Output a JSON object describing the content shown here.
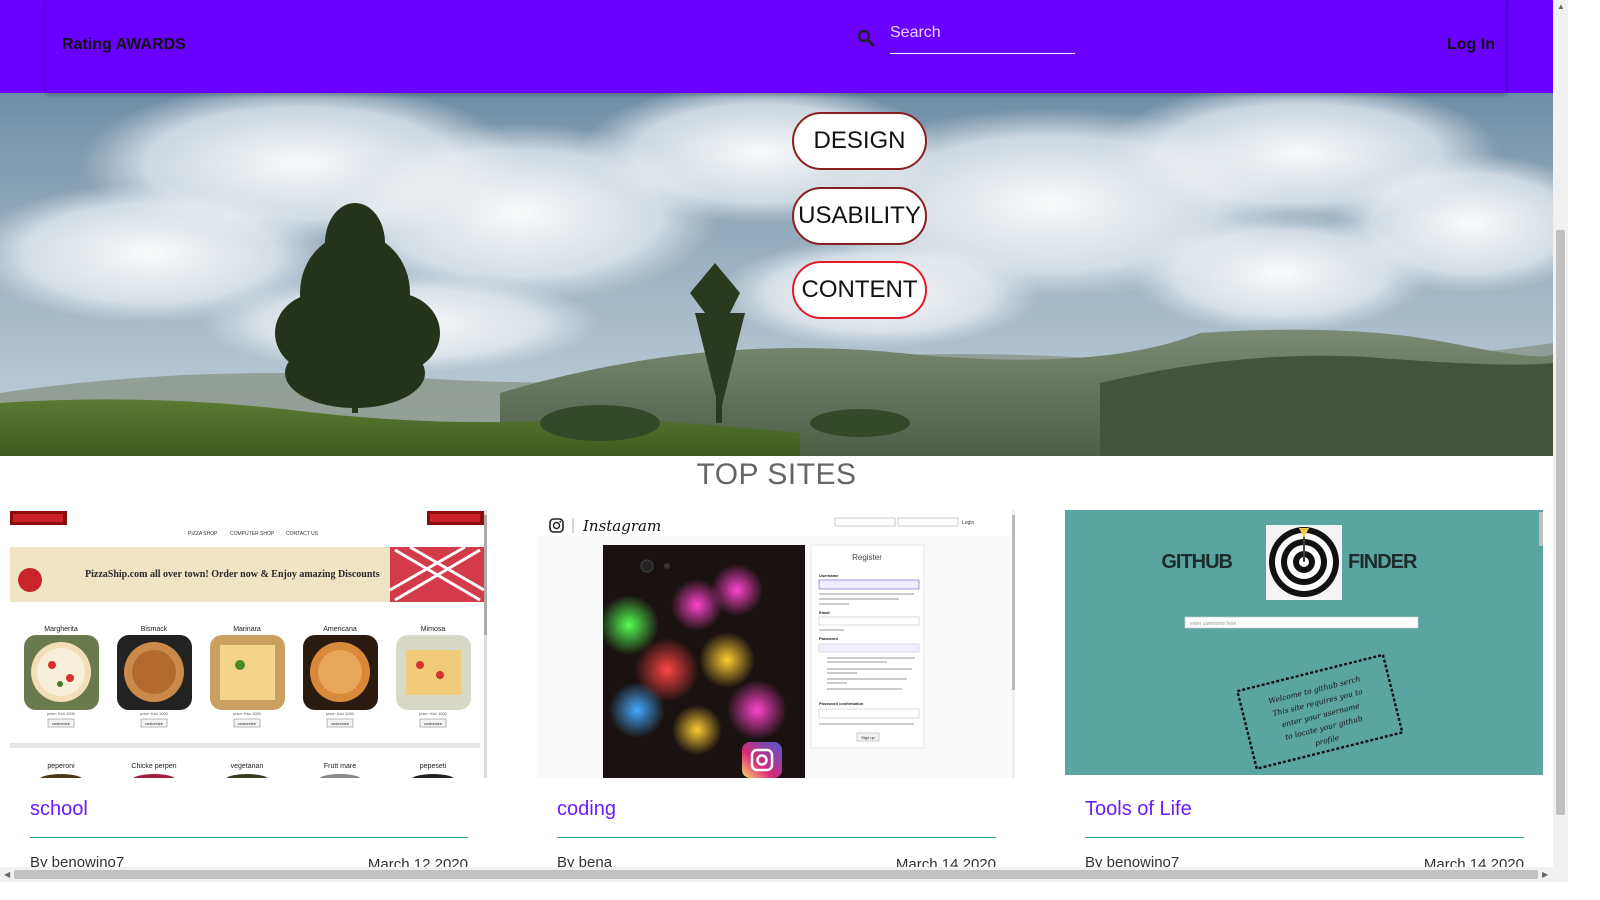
{
  "navbar": {
    "brand": "Rating AWARDS",
    "search_placeholder": "Search",
    "login": "Log In"
  },
  "hero": {
    "buttons": [
      "DESIGN",
      "USABILITY",
      "CONTENT"
    ]
  },
  "section_title": "TOP SITES",
  "cards": [
    {
      "title": "school",
      "author": "By benowino7",
      "date": "March 12 2020",
      "screenshot": {
        "nav": [
          "PIZZA SHOP",
          "COMPUTER SHOP",
          "CONTACT US"
        ],
        "banner": "PizzaShip.com all over town! Order now & Enjoy amazing Discounts",
        "pizzas_row1": [
          "Margherita",
          "Bismack",
          "Marinara",
          "Americana",
          "Mimosa"
        ],
        "pizzas_row2": [
          "peperoni",
          "Chicke perperi",
          "vegetarian",
          "Frutt mare",
          "pepeseti"
        ],
        "price_label": "price: Ksh 1000",
        "button_label": "customize"
      }
    },
    {
      "title": "coding",
      "author": "By bena",
      "date": "March 14 2020",
      "screenshot": {
        "brand": "Instagram",
        "form_title": "Register",
        "username_label": "Username",
        "email_label": "Email",
        "password_label": "Password",
        "confirm_label": "Password confirmation",
        "submit": "Sign up",
        "login_button": "Login"
      }
    },
    {
      "title": "Tools of Life",
      "author": "By benowino7",
      "date": "March 14 2020",
      "screenshot": {
        "logo_left": "GITHUB",
        "logo_right": "FINDER",
        "input_placeholder": "enter username here",
        "note": [
          "Welcome to github serch",
          "This site requires you to",
          "enter your username",
          "to locate your github",
          "profile"
        ]
      }
    }
  ],
  "colors": {
    "navbar": "#6a00ff",
    "accent_title": "#6a1bff",
    "rule": "#26a69a",
    "pill_border": "#8a1f1f",
    "pill_border_active": "#e21b2b",
    "github_bg": "#5ba5a0"
  },
  "icons": {
    "search": "search-icon",
    "instagram": "instagram-icon",
    "target": "target-icon"
  }
}
